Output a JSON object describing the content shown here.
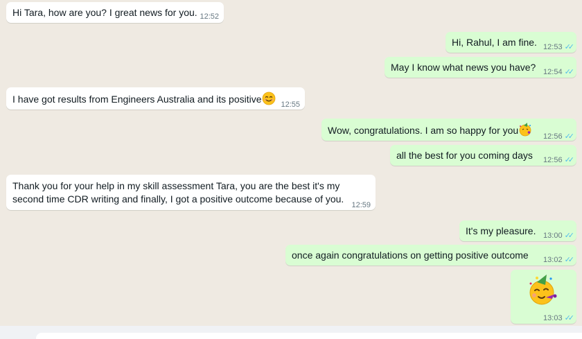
{
  "messages": [
    {
      "dir": "in",
      "text": "Hi Tara, how are you? I great news for you.",
      "time": "12:52"
    },
    {
      "dir": "out",
      "text": "Hi, Rahul, I am fine.",
      "time": "12:53"
    },
    {
      "dir": "out",
      "text": "May I know what news you have?",
      "time": "12:54"
    },
    {
      "dir": "in",
      "text": "I have got results from Engineers Australia and its positive",
      "time": "12:55",
      "emoji": "smiling-face-icon"
    },
    {
      "dir": "out",
      "text": "Wow, congratulations. I am so happy for you",
      "time": "12:56",
      "emoji": "party-face-icon"
    },
    {
      "dir": "out",
      "text": "all the best for you coming days",
      "time": "12:56"
    },
    {
      "dir": "in",
      "text_lines": [
        "Thank you for your help in my skill assessment Tara, you are the best it's my",
        "second time CDR writing and finally, I got a positive outcome because of you."
      ],
      "time": "12:59"
    },
    {
      "dir": "out",
      "text": "It's my pleasure.",
      "time": "13:00"
    },
    {
      "dir": "out",
      "text": "once again congratulations on getting positive outcome",
      "time": "13:02"
    },
    {
      "dir": "out",
      "sticker": "party-face-icon",
      "time": "13:03"
    }
  ],
  "colors": {
    "background": "#efeae2",
    "incoming_bubble": "#ffffff",
    "outgoing_bubble": "#d9fdd3",
    "read_ticks": "#53bdeb"
  }
}
